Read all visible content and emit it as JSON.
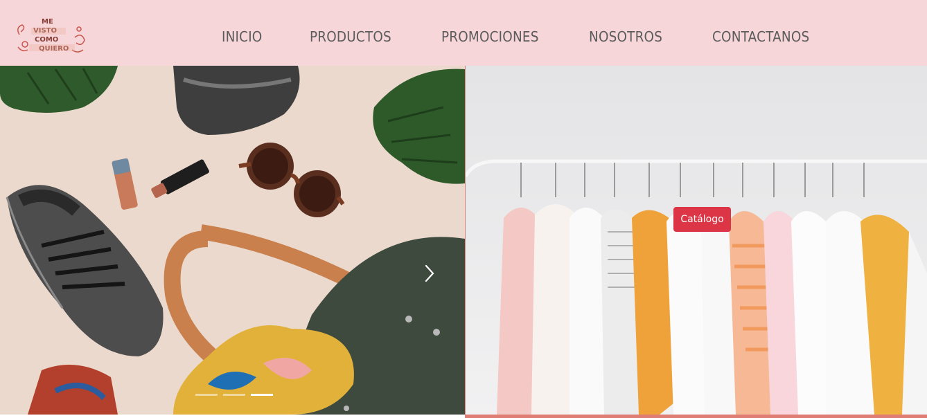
{
  "brand": {
    "logo_text": "ME VISTO COMO QUIERO",
    "colors": {
      "header_bg": "#f7d6da",
      "accent": "#dc3545",
      "nav_text": "#5b5b5b"
    }
  },
  "nav": {
    "items": [
      {
        "label": "INICIO"
      },
      {
        "label": "PRODUCTOS"
      },
      {
        "label": "PROMOCIONES"
      },
      {
        "label": "NOSOTROS"
      },
      {
        "label": "CONTACTANOS"
      }
    ]
  },
  "carousel": {
    "image": "flat-lay-accessories-photo",
    "next_icon": "chevron-right-icon",
    "slide_count": 3,
    "active_slide": 3
  },
  "catalog": {
    "image": "clothes-rack-photo",
    "button_label": "Catálogo"
  }
}
